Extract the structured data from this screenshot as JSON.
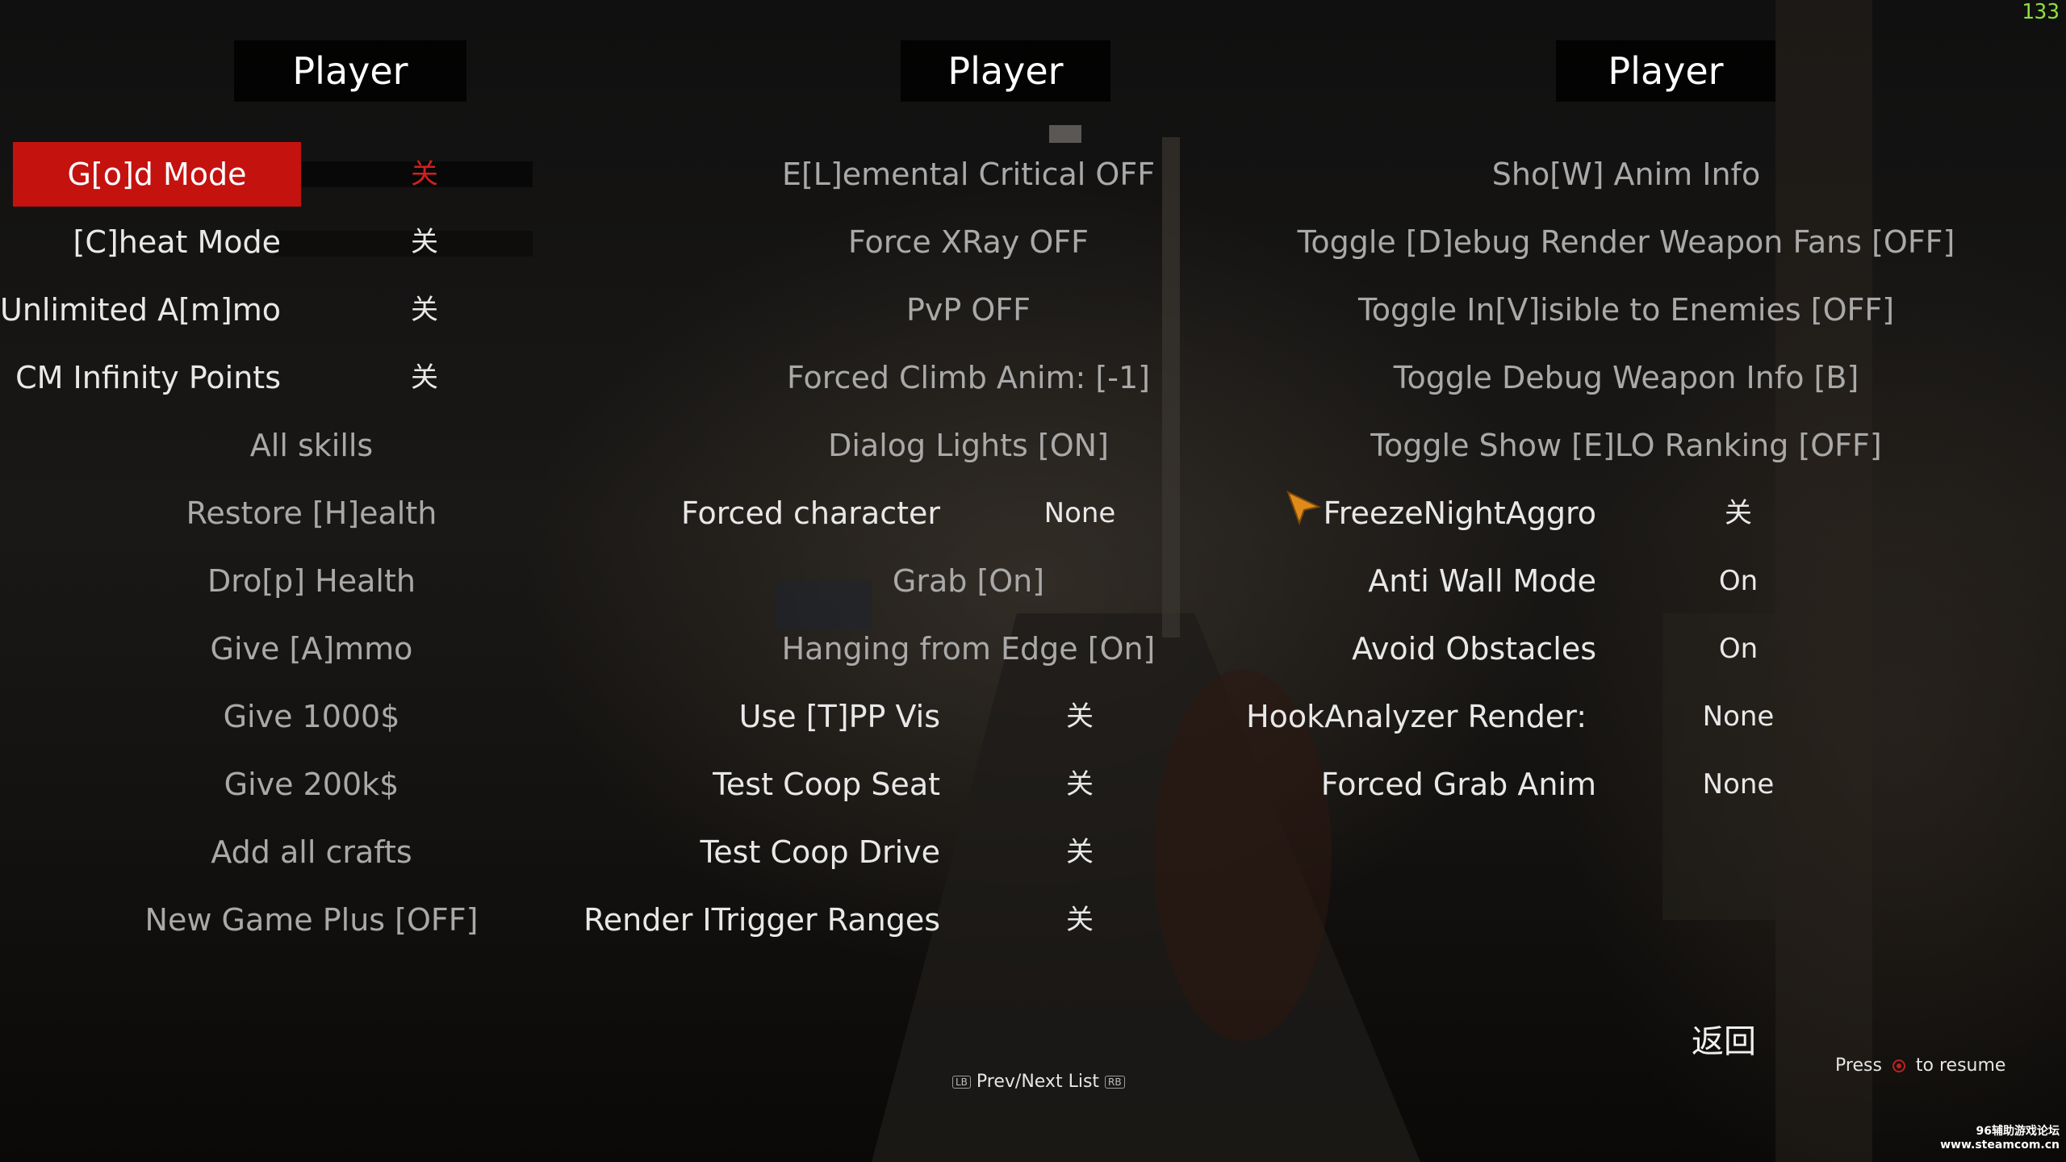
{
  "fps_counter": "133",
  "columns": [
    {
      "header": "Player",
      "items": [
        {
          "label": "G[o]d Mode",
          "value": "关",
          "selected": true
        },
        {
          "label": "[C]heat Mode",
          "value": "关"
        },
        {
          "label": "Unlimited A[m]mo",
          "value": "关"
        },
        {
          "label": "CM Infinity Points",
          "value": "关"
        },
        {
          "label": "All skills"
        },
        {
          "label": "Restore [H]ealth"
        },
        {
          "label": "Dro[p] Health"
        },
        {
          "label": "Give [A]mmo"
        },
        {
          "label": "Give 1000$"
        },
        {
          "label": "Give 200k$"
        },
        {
          "label": "Add all crafts"
        },
        {
          "label": "New Game Plus [OFF]"
        }
      ]
    },
    {
      "header": "Player",
      "items": [
        {
          "label": "E[L]emental Critical OFF"
        },
        {
          "label": "Force XRay OFF"
        },
        {
          "label": "PvP OFF"
        },
        {
          "label": "Forced Climb Anim: [-1]"
        },
        {
          "label": "Dialog Lights [ON]"
        },
        {
          "label": "Forced character",
          "value": "None"
        },
        {
          "label": "Grab [On]"
        },
        {
          "label": "Hanging from Edge [On]"
        },
        {
          "label": "Use [T]PP Vis",
          "value": "关"
        },
        {
          "label": "Test Coop Seat",
          "value": "关"
        },
        {
          "label": "Test Coop Drive",
          "value": "关"
        },
        {
          "label": "Render ITrigger Ranges",
          "value": "关"
        }
      ]
    },
    {
      "header": "Player",
      "items": [
        {
          "label": "Sho[W] Anim Info"
        },
        {
          "label": "Toggle [D]ebug Render Weapon Fans [OFF]"
        },
        {
          "label": "Toggle In[V]isible to Enemies [OFF]"
        },
        {
          "label": "Toggle Debug Weapon Info [B]"
        },
        {
          "label": "Toggle Show [E]LO Ranking [OFF]"
        },
        {
          "label": "FreezeNightAggro",
          "value": "关"
        },
        {
          "label": "Anti Wall Mode",
          "value": "On"
        },
        {
          "label": "Avoid Obstacles",
          "value": "On"
        },
        {
          "label": "HookAnalyzer Render:",
          "value": "None"
        },
        {
          "label": "Forced Grab Anim",
          "value": "None"
        }
      ]
    }
  ],
  "footer": {
    "back_label": "返回",
    "lb_label": "LB",
    "prev_next_label": "Prev/Next List",
    "rb_label": "RB",
    "press_label": "Press",
    "resume_label": "to resume"
  },
  "watermark": {
    "line1": "96辅助游戏论坛",
    "line2": "www.steamcom.cn"
  },
  "colors": {
    "selection": "#c4120f",
    "cursor": "#e08a1a",
    "fps": "#8fdc3c"
  }
}
